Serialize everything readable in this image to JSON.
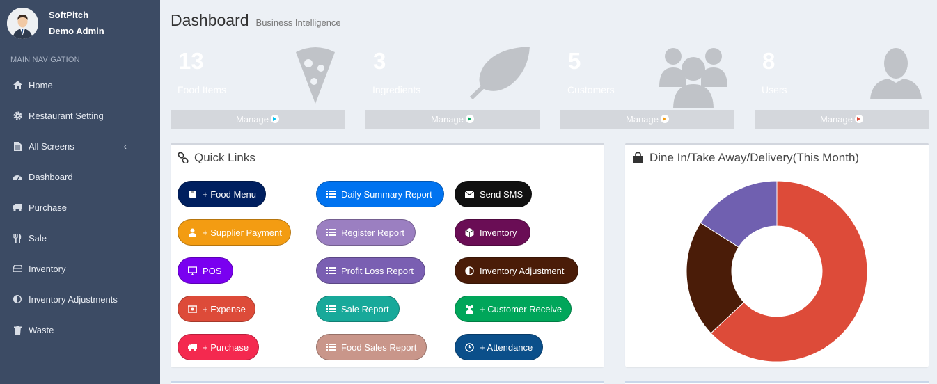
{
  "user": {
    "company": "SoftPitch",
    "role": "Demo Admin"
  },
  "nav": {
    "header": "MAIN NAVIGATION",
    "items": [
      {
        "label": "Home",
        "icon": "home-icon"
      },
      {
        "label": "Restaurant Setting",
        "icon": "gear-icon"
      },
      {
        "label": "All Screens",
        "icon": "file-icon"
      },
      {
        "label": "Dashboard",
        "icon": "dashboard-icon"
      },
      {
        "label": "Purchase",
        "icon": "truck-icon"
      },
      {
        "label": "Sale",
        "icon": "cutlery-icon"
      },
      {
        "label": "Inventory",
        "icon": "hdd-icon"
      },
      {
        "label": "Inventory Adjustments",
        "icon": "adjust-icon"
      },
      {
        "label": "Waste",
        "icon": "trash-icon"
      }
    ],
    "all_screens_chevron": "‹"
  },
  "page": {
    "title": "Dashboard",
    "subtitle": "Business Intelligence"
  },
  "stats": [
    {
      "value": "13",
      "label": "Food Items",
      "footer": "Manage",
      "color": "#00c0ef",
      "icon": "pizza-icon"
    },
    {
      "value": "3",
      "label": "Ingredients",
      "footer": "Manage",
      "color": "#00a65a",
      "icon": "leaf-icon"
    },
    {
      "value": "5",
      "label": "Customers",
      "footer": "Manage",
      "color": "#f39c12",
      "icon": "users-icon"
    },
    {
      "value": "8",
      "label": "Users",
      "footer": "Manage",
      "color": "#dd4b39",
      "icon": "user-icon"
    }
  ],
  "quick_links": {
    "title": "Quick Links",
    "buttons": [
      {
        "label": "+ Food Menu",
        "color": "#001f5f",
        "icon": "book-icon"
      },
      {
        "label": "Daily Summary Report",
        "color": "#0073f0",
        "icon": "list-icon"
      },
      {
        "label": "Send SMS",
        "color": "#111111",
        "icon": "envelope-icon"
      },
      {
        "label": "+ Supplier Payment",
        "color": "#f39c12",
        "icon": "user-icon"
      },
      {
        "label": "Register Report",
        "color": "#9b7fc1",
        "icon": "list-icon"
      },
      {
        "label": "Inventory",
        "color": "#6a0d55",
        "icon": "cube-icon"
      },
      {
        "label": "POS",
        "color": "#7a00f0",
        "icon": "monitor-icon"
      },
      {
        "label": "Profit Loss Report",
        "color": "#7a5fb2",
        "icon": "list-icon"
      },
      {
        "label": "Inventory Adjustment",
        "color": "#4a1c08",
        "icon": "adjust-icon"
      },
      {
        "label": "+ Expense",
        "color": "#dd4b39",
        "icon": "money-icon"
      },
      {
        "label": "Sale Report",
        "color": "#18a99a",
        "icon": "list-icon"
      },
      {
        "label": "+ Customer Receive",
        "color": "#00a65a",
        "icon": "users-icon"
      },
      {
        "label": "+ Purchase",
        "color": "#f4294f",
        "icon": "truck-icon"
      },
      {
        "label": "Food Sales Report",
        "color": "#c9968a",
        "icon": "list-icon"
      },
      {
        "label": "+ Attendance",
        "color": "#0b4f8a",
        "icon": "clock-icon"
      }
    ]
  },
  "donut": {
    "title": "Dine In/Take Away/Delivery(This Month)",
    "icon": "shopping-bag-icon"
  },
  "chart_data": {
    "type": "pie",
    "title": "Dine In/Take Away/Delivery(This Month)",
    "slices": [
      {
        "value": 63,
        "color": "#dd4b39"
      },
      {
        "value": 21,
        "color": "#4a1c08"
      },
      {
        "value": 16,
        "color": "#7060b0"
      }
    ]
  }
}
